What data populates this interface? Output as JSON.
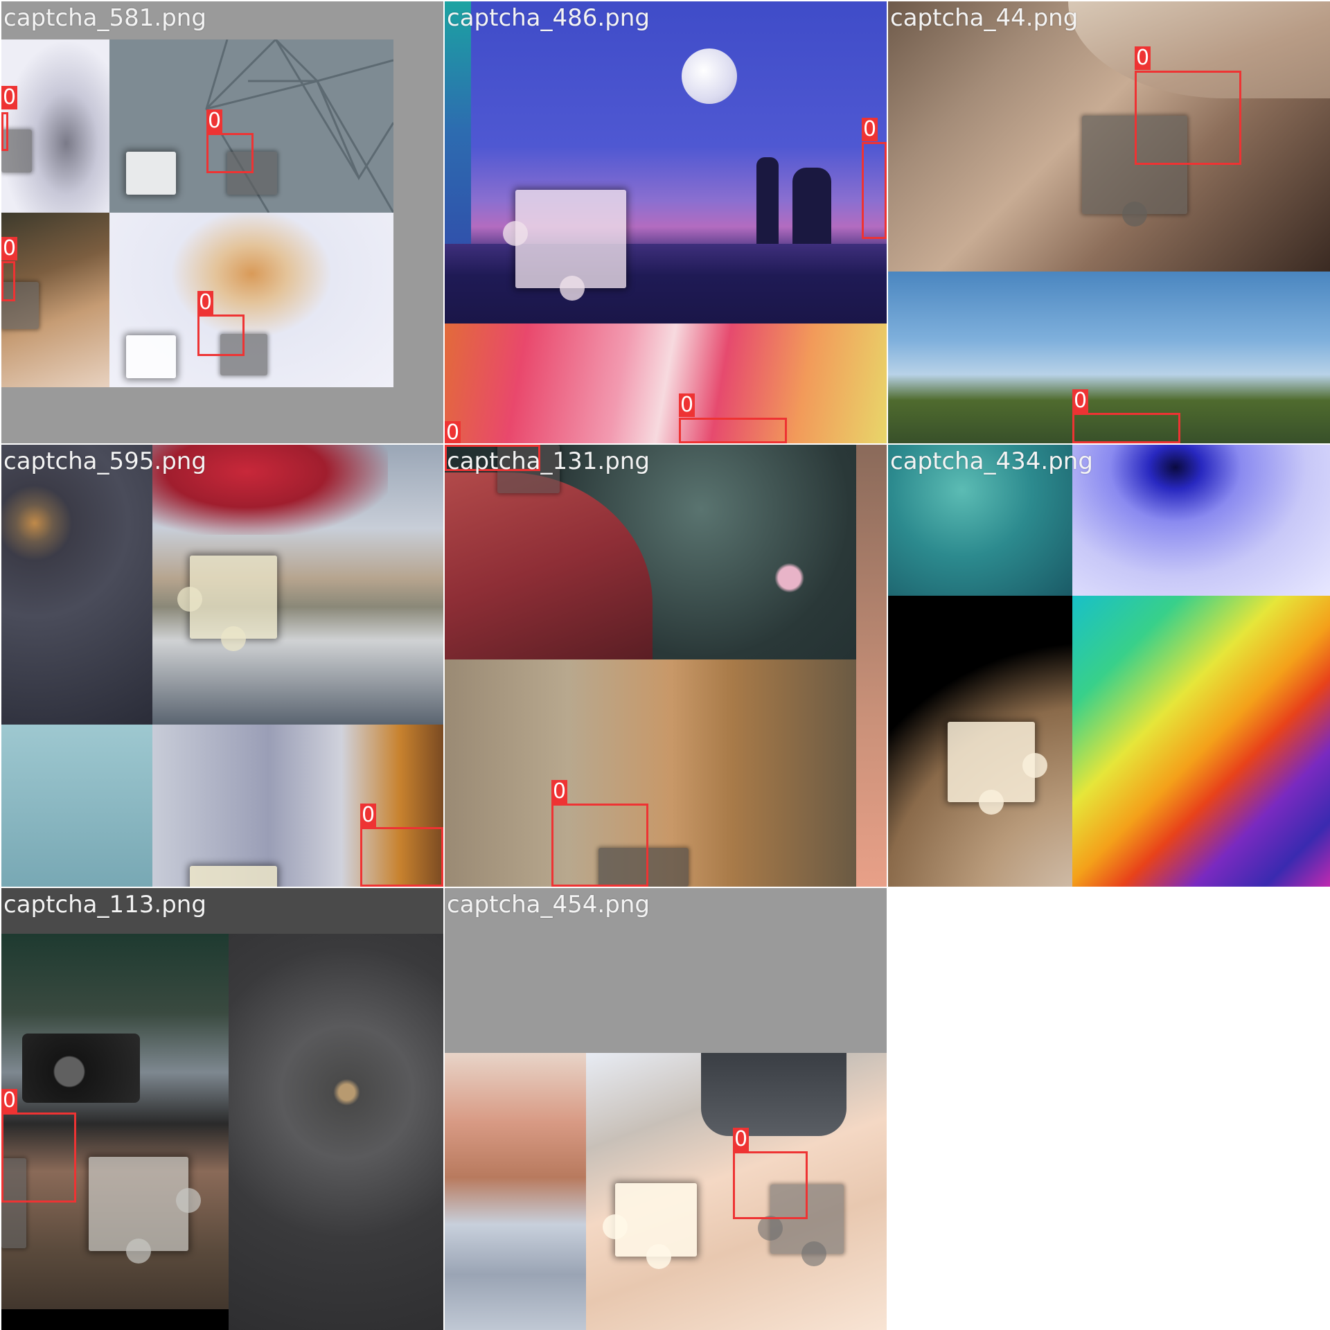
{
  "tiles": [
    {
      "label": "captcha_581.png",
      "boxes": [
        {
          "tag": "0"
        },
        {
          "tag": "0"
        },
        {
          "tag": "0"
        },
        {
          "tag": "0"
        }
      ]
    },
    {
      "label": "captcha_486.png",
      "boxes": [
        {
          "tag": "0"
        },
        {
          "tag": "0"
        },
        {
          "tag": "0"
        }
      ]
    },
    {
      "label": "captcha_44.png",
      "boxes": [
        {
          "tag": "0"
        },
        {
          "tag": "0"
        }
      ]
    },
    {
      "label": "captcha_595.png",
      "boxes": [
        {
          "tag": "0"
        }
      ]
    },
    {
      "label": "captcha_131.png",
      "boxes": [
        {
          "tag": "0"
        }
      ]
    },
    {
      "label": "captcha_434.png",
      "boxes": []
    },
    {
      "label": "captcha_113.png",
      "boxes": [
        {
          "tag": "0"
        }
      ]
    },
    {
      "label": "captcha_454.png",
      "boxes": [
        {
          "tag": "0"
        }
      ]
    }
  ],
  "colors": {
    "bbox": "#ee3333",
    "tile_background": "#9a9a9a",
    "page_background": "#ffffff"
  }
}
